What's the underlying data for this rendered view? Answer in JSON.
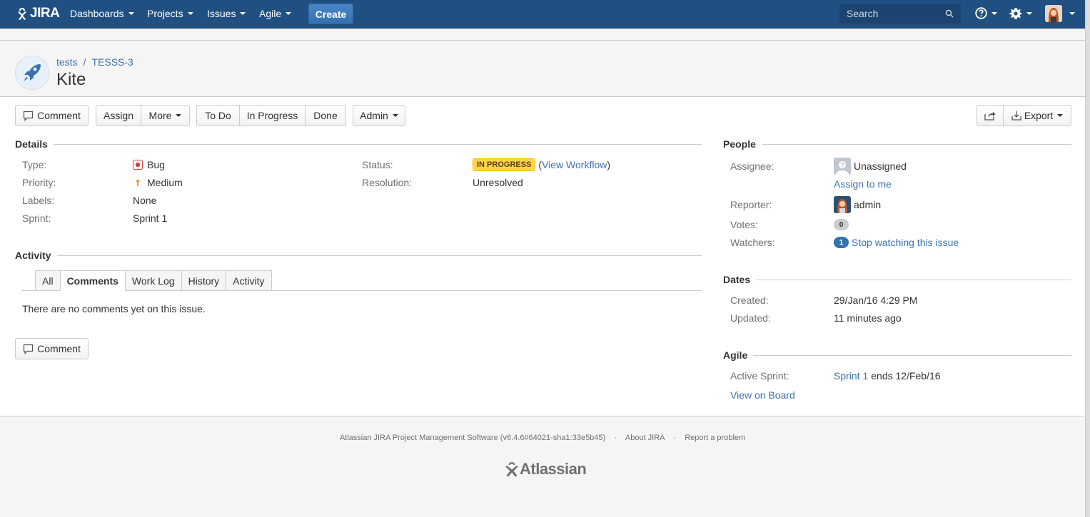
{
  "nav": {
    "logo": "JIRA",
    "items": [
      "Dashboards",
      "Projects",
      "Issues",
      "Agile"
    ],
    "create_label": "Create",
    "search_placeholder": "Search",
    "colors": {
      "bar": "#205081",
      "create": "#3572b0"
    }
  },
  "header": {
    "project": "tests",
    "issue_key": "TESSS-3",
    "title": "Kite"
  },
  "toolbar": {
    "comment": "Comment",
    "assign": "Assign",
    "more": "More",
    "todo": "To Do",
    "in_progress": "In Progress",
    "done": "Done",
    "admin": "Admin",
    "export": "Export"
  },
  "details": {
    "heading": "Details",
    "type_label": "Type:",
    "type_value": "Bug",
    "priority_label": "Priority:",
    "priority_value": "Medium",
    "labels_label": "Labels:",
    "labels_value": "None",
    "sprint_label": "Sprint:",
    "sprint_value": "Sprint 1",
    "status_label": "Status:",
    "status_value": "IN PROGRESS",
    "view_workflow": "View Workflow",
    "resolution_label": "Resolution:",
    "resolution_value": "Unresolved"
  },
  "activity": {
    "heading": "Activity",
    "tabs": [
      "All",
      "Comments",
      "Work Log",
      "History",
      "Activity"
    ],
    "active_tab": "Comments",
    "empty_text": "There are no comments yet on this issue.",
    "comment_button": "Comment"
  },
  "people": {
    "heading": "People",
    "assignee_label": "Assignee:",
    "assignee_value": "Unassigned",
    "assign_to_me": "Assign to me",
    "reporter_label": "Reporter:",
    "reporter_value": "admin",
    "votes_label": "Votes:",
    "votes_count": "0",
    "watchers_label": "Watchers:",
    "watchers_count": "1",
    "stop_watching": "Stop watching this issue"
  },
  "dates": {
    "heading": "Dates",
    "created_label": "Created:",
    "created_value": "29/Jan/16 4:29 PM",
    "updated_label": "Updated:",
    "updated_value": "11 minutes ago"
  },
  "agile": {
    "heading": "Agile",
    "active_sprint_label": "Active Sprint:",
    "sprint_link": "Sprint 1",
    "sprint_ends": "ends 12/Feb/16",
    "view_on_board": "View on Board"
  },
  "footer": {
    "software": "Atlassian JIRA Project Management Software (v6.4.6#64021-sha1:33e5b45)",
    "about": "About JIRA",
    "report": "Report a problem",
    "brand": "Atlassian"
  }
}
